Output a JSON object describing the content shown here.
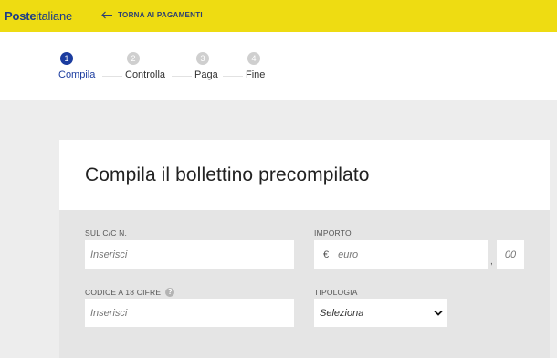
{
  "header": {
    "logo_bold": "Poste",
    "logo_rest": "italiane",
    "back_label": "TORNA AI PAGAMENTI"
  },
  "steps": [
    {
      "num": "1",
      "label": "Compila"
    },
    {
      "num": "2",
      "label": "Controlla"
    },
    {
      "num": "3",
      "label": "Paga"
    },
    {
      "num": "4",
      "label": "Fine"
    }
  ],
  "form": {
    "title": "Compila il bollettino precompilato",
    "account_label": "SUL C/C N.",
    "account_placeholder": "Inserisci",
    "amount_label": "IMPORTO",
    "currency_symbol": "€",
    "amount_placeholder": "euro",
    "decimal_separator": ",",
    "cents_placeholder": "00",
    "code_label": "CODICE A 18 CIFRE",
    "code_help": "?",
    "code_placeholder": "Inserisci",
    "type_label": "TIPOLOGIA",
    "type_selected": "Seleziona"
  },
  "colors": {
    "brand_yellow": "#eedc12",
    "brand_blue": "#1b3c9f",
    "step_inactive": "#cfcfcf",
    "page_bg": "#ededed",
    "form_bg": "#e5e5e5"
  },
  "icons": {
    "back": "arrow-left-icon",
    "select": "chevron-down-icon",
    "help": "question-icon"
  }
}
